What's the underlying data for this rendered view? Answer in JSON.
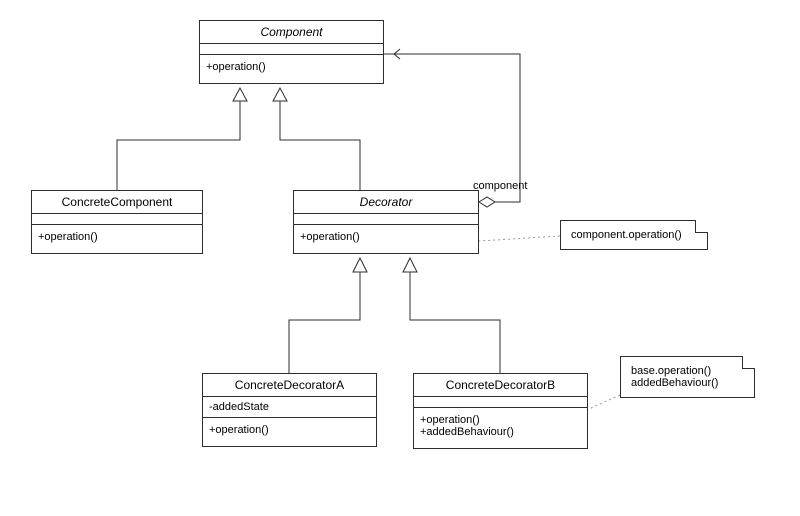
{
  "classes": {
    "component": {
      "name": "Component",
      "ops": [
        "+operation()"
      ]
    },
    "concreteComponent": {
      "name": "ConcreteComponent",
      "ops": [
        "+operation()"
      ]
    },
    "decorator": {
      "name": "Decorator",
      "ops": [
        "+operation()"
      ]
    },
    "concreteDecoratorA": {
      "name": "ConcreteDecoratorA",
      "attrs": [
        "-addedState"
      ],
      "ops": [
        "+operation()"
      ]
    },
    "concreteDecoratorB": {
      "name": "ConcreteDecoratorB",
      "ops": [
        "+operation()",
        "+addedBehaviour()"
      ]
    }
  },
  "notes": {
    "note1": {
      "lines": [
        "component.operation()"
      ]
    },
    "note2": {
      "lines": [
        "base.operation()",
        "addedBehaviour()"
      ]
    }
  },
  "roles": {
    "componentRole": "component"
  },
  "chart_data": {
    "type": "uml-class-diagram",
    "pattern": "Decorator",
    "classes": [
      {
        "name": "Component",
        "abstract": true,
        "attributes": [],
        "operations": [
          "+operation()"
        ]
      },
      {
        "name": "ConcreteComponent",
        "abstract": false,
        "attributes": [],
        "operations": [
          "+operation()"
        ]
      },
      {
        "name": "Decorator",
        "abstract": true,
        "attributes": [],
        "operations": [
          "+operation()"
        ]
      },
      {
        "name": "ConcreteDecoratorA",
        "abstract": false,
        "attributes": [
          "-addedState"
        ],
        "operations": [
          "+operation()"
        ]
      },
      {
        "name": "ConcreteDecoratorB",
        "abstract": false,
        "attributes": [],
        "operations": [
          "+operation()",
          "+addedBehaviour()"
        ]
      }
    ],
    "relations": [
      {
        "from": "ConcreteComponent",
        "to": "Component",
        "type": "generalization"
      },
      {
        "from": "Decorator",
        "to": "Component",
        "type": "generalization"
      },
      {
        "from": "ConcreteDecoratorA",
        "to": "Decorator",
        "type": "generalization"
      },
      {
        "from": "ConcreteDecoratorB",
        "to": "Decorator",
        "type": "generalization"
      },
      {
        "from": "Decorator",
        "to": "Component",
        "type": "aggregation",
        "role": "component"
      }
    ],
    "notes": [
      {
        "attachedTo": "Decorator.operation",
        "text": [
          "component.operation()"
        ]
      },
      {
        "attachedTo": "ConcreteDecoratorB.operation",
        "text": [
          "base.operation()",
          "addedBehaviour()"
        ]
      }
    ]
  }
}
